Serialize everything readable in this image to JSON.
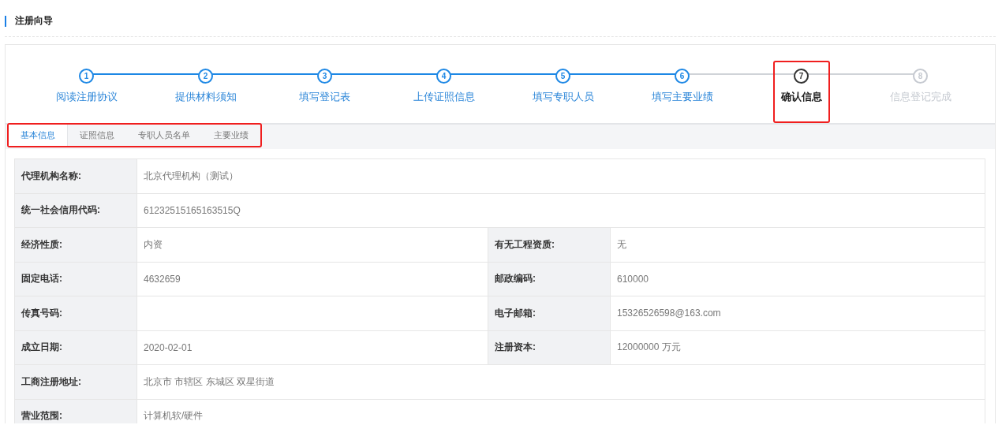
{
  "header": {
    "title": "注册向导"
  },
  "steps": [
    {
      "number": "1",
      "label": "阅读注册协议",
      "completed": true,
      "current": false,
      "highlighted": false
    },
    {
      "number": "2",
      "label": "提供材料须知",
      "completed": true,
      "current": false,
      "highlighted": false
    },
    {
      "number": "3",
      "label": "填写登记表",
      "completed": true,
      "current": false,
      "highlighted": false
    },
    {
      "number": "4",
      "label": "上传证照信息",
      "completed": true,
      "current": false,
      "highlighted": false
    },
    {
      "number": "5",
      "label": "填写专职人员",
      "completed": true,
      "current": false,
      "highlighted": false
    },
    {
      "number": "6",
      "label": "填写主要业绩",
      "completed": true,
      "current": false,
      "highlighted": false
    },
    {
      "number": "7",
      "label": "确认信息",
      "completed": false,
      "current": true,
      "highlighted": true
    },
    {
      "number": "8",
      "label": "信息登记完成",
      "completed": false,
      "current": false,
      "highlighted": false
    }
  ],
  "tabs_highlighted": true,
  "tabs": [
    {
      "label": "基本信息",
      "selected": true
    },
    {
      "label": "证照信息",
      "selected": false
    },
    {
      "label": "专职人员名单",
      "selected": false
    },
    {
      "label": "主要业绩",
      "selected": false
    }
  ],
  "rows": [
    [
      {
        "label": "代理机构名称:",
        "value": "北京代理机构（测试）"
      }
    ],
    [
      {
        "label": "统一社会信用代码:",
        "value": "61232515165163515Q"
      }
    ],
    [
      {
        "label": "经济性质:",
        "value": "内资"
      },
      {
        "label": "有无工程资质:",
        "value": "无"
      }
    ],
    [
      {
        "label": "固定电话:",
        "value": "4632659"
      },
      {
        "label": "邮政编码:",
        "value": "610000"
      }
    ],
    [
      {
        "label": "传真号码:"
      },
      {
        "label": "电子邮箱:",
        "value": "15326526598@163.com"
      }
    ],
    [
      {
        "label": "成立日期:",
        "value": "2020-02-01"
      },
      {
        "label": "注册资本:",
        "value": "12000000 万元"
      }
    ],
    [
      {
        "label": "工商注册地址:",
        "value": "北京市 市辖区 东城区 双星街道"
      }
    ],
    [
      {
        "label": "营业范围:",
        "value": "计算机软/硬件"
      }
    ]
  ]
}
